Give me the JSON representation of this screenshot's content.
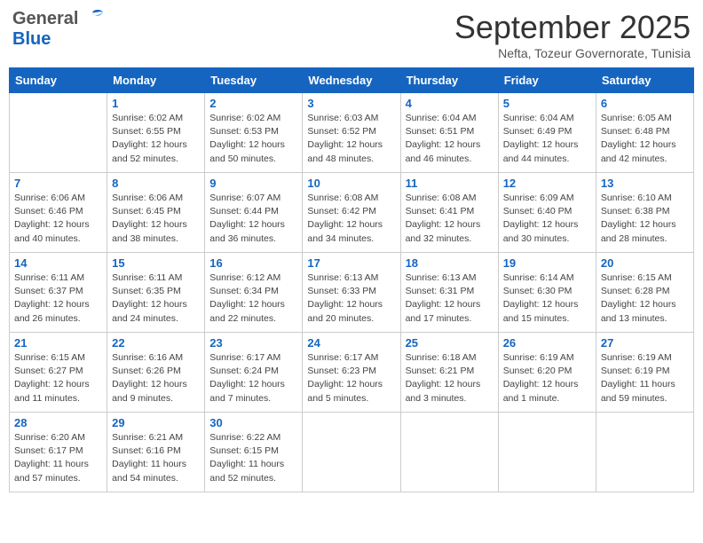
{
  "header": {
    "logo_general": "General",
    "logo_blue": "Blue",
    "month": "September 2025",
    "location": "Nefta, Tozeur Governorate, Tunisia"
  },
  "weekdays": [
    "Sunday",
    "Monday",
    "Tuesday",
    "Wednesday",
    "Thursday",
    "Friday",
    "Saturday"
  ],
  "weeks": [
    [
      {
        "day": "",
        "sunrise": "",
        "sunset": "",
        "daylight": ""
      },
      {
        "day": "1",
        "sunrise": "Sunrise: 6:02 AM",
        "sunset": "Sunset: 6:55 PM",
        "daylight": "Daylight: 12 hours and 52 minutes."
      },
      {
        "day": "2",
        "sunrise": "Sunrise: 6:02 AM",
        "sunset": "Sunset: 6:53 PM",
        "daylight": "Daylight: 12 hours and 50 minutes."
      },
      {
        "day": "3",
        "sunrise": "Sunrise: 6:03 AM",
        "sunset": "Sunset: 6:52 PM",
        "daylight": "Daylight: 12 hours and 48 minutes."
      },
      {
        "day": "4",
        "sunrise": "Sunrise: 6:04 AM",
        "sunset": "Sunset: 6:51 PM",
        "daylight": "Daylight: 12 hours and 46 minutes."
      },
      {
        "day": "5",
        "sunrise": "Sunrise: 6:04 AM",
        "sunset": "Sunset: 6:49 PM",
        "daylight": "Daylight: 12 hours and 44 minutes."
      },
      {
        "day": "6",
        "sunrise": "Sunrise: 6:05 AM",
        "sunset": "Sunset: 6:48 PM",
        "daylight": "Daylight: 12 hours and 42 minutes."
      }
    ],
    [
      {
        "day": "7",
        "sunrise": "Sunrise: 6:06 AM",
        "sunset": "Sunset: 6:46 PM",
        "daylight": "Daylight: 12 hours and 40 minutes."
      },
      {
        "day": "8",
        "sunrise": "Sunrise: 6:06 AM",
        "sunset": "Sunset: 6:45 PM",
        "daylight": "Daylight: 12 hours and 38 minutes."
      },
      {
        "day": "9",
        "sunrise": "Sunrise: 6:07 AM",
        "sunset": "Sunset: 6:44 PM",
        "daylight": "Daylight: 12 hours and 36 minutes."
      },
      {
        "day": "10",
        "sunrise": "Sunrise: 6:08 AM",
        "sunset": "Sunset: 6:42 PM",
        "daylight": "Daylight: 12 hours and 34 minutes."
      },
      {
        "day": "11",
        "sunrise": "Sunrise: 6:08 AM",
        "sunset": "Sunset: 6:41 PM",
        "daylight": "Daylight: 12 hours and 32 minutes."
      },
      {
        "day": "12",
        "sunrise": "Sunrise: 6:09 AM",
        "sunset": "Sunset: 6:40 PM",
        "daylight": "Daylight: 12 hours and 30 minutes."
      },
      {
        "day": "13",
        "sunrise": "Sunrise: 6:10 AM",
        "sunset": "Sunset: 6:38 PM",
        "daylight": "Daylight: 12 hours and 28 minutes."
      }
    ],
    [
      {
        "day": "14",
        "sunrise": "Sunrise: 6:11 AM",
        "sunset": "Sunset: 6:37 PM",
        "daylight": "Daylight: 12 hours and 26 minutes."
      },
      {
        "day": "15",
        "sunrise": "Sunrise: 6:11 AM",
        "sunset": "Sunset: 6:35 PM",
        "daylight": "Daylight: 12 hours and 24 minutes."
      },
      {
        "day": "16",
        "sunrise": "Sunrise: 6:12 AM",
        "sunset": "Sunset: 6:34 PM",
        "daylight": "Daylight: 12 hours and 22 minutes."
      },
      {
        "day": "17",
        "sunrise": "Sunrise: 6:13 AM",
        "sunset": "Sunset: 6:33 PM",
        "daylight": "Daylight: 12 hours and 20 minutes."
      },
      {
        "day": "18",
        "sunrise": "Sunrise: 6:13 AM",
        "sunset": "Sunset: 6:31 PM",
        "daylight": "Daylight: 12 hours and 17 minutes."
      },
      {
        "day": "19",
        "sunrise": "Sunrise: 6:14 AM",
        "sunset": "Sunset: 6:30 PM",
        "daylight": "Daylight: 12 hours and 15 minutes."
      },
      {
        "day": "20",
        "sunrise": "Sunrise: 6:15 AM",
        "sunset": "Sunset: 6:28 PM",
        "daylight": "Daylight: 12 hours and 13 minutes."
      }
    ],
    [
      {
        "day": "21",
        "sunrise": "Sunrise: 6:15 AM",
        "sunset": "Sunset: 6:27 PM",
        "daylight": "Daylight: 12 hours and 11 minutes."
      },
      {
        "day": "22",
        "sunrise": "Sunrise: 6:16 AM",
        "sunset": "Sunset: 6:26 PM",
        "daylight": "Daylight: 12 hours and 9 minutes."
      },
      {
        "day": "23",
        "sunrise": "Sunrise: 6:17 AM",
        "sunset": "Sunset: 6:24 PM",
        "daylight": "Daylight: 12 hours and 7 minutes."
      },
      {
        "day": "24",
        "sunrise": "Sunrise: 6:17 AM",
        "sunset": "Sunset: 6:23 PM",
        "daylight": "Daylight: 12 hours and 5 minutes."
      },
      {
        "day": "25",
        "sunrise": "Sunrise: 6:18 AM",
        "sunset": "Sunset: 6:21 PM",
        "daylight": "Daylight: 12 hours and 3 minutes."
      },
      {
        "day": "26",
        "sunrise": "Sunrise: 6:19 AM",
        "sunset": "Sunset: 6:20 PM",
        "daylight": "Daylight: 12 hours and 1 minute."
      },
      {
        "day": "27",
        "sunrise": "Sunrise: 6:19 AM",
        "sunset": "Sunset: 6:19 PM",
        "daylight": "Daylight: 11 hours and 59 minutes."
      }
    ],
    [
      {
        "day": "28",
        "sunrise": "Sunrise: 6:20 AM",
        "sunset": "Sunset: 6:17 PM",
        "daylight": "Daylight: 11 hours and 57 minutes."
      },
      {
        "day": "29",
        "sunrise": "Sunrise: 6:21 AM",
        "sunset": "Sunset: 6:16 PM",
        "daylight": "Daylight: 11 hours and 54 minutes."
      },
      {
        "day": "30",
        "sunrise": "Sunrise: 6:22 AM",
        "sunset": "Sunset: 6:15 PM",
        "daylight": "Daylight: 11 hours and 52 minutes."
      },
      {
        "day": "",
        "sunrise": "",
        "sunset": "",
        "daylight": ""
      },
      {
        "day": "",
        "sunrise": "",
        "sunset": "",
        "daylight": ""
      },
      {
        "day": "",
        "sunrise": "",
        "sunset": "",
        "daylight": ""
      },
      {
        "day": "",
        "sunrise": "",
        "sunset": "",
        "daylight": ""
      }
    ]
  ]
}
